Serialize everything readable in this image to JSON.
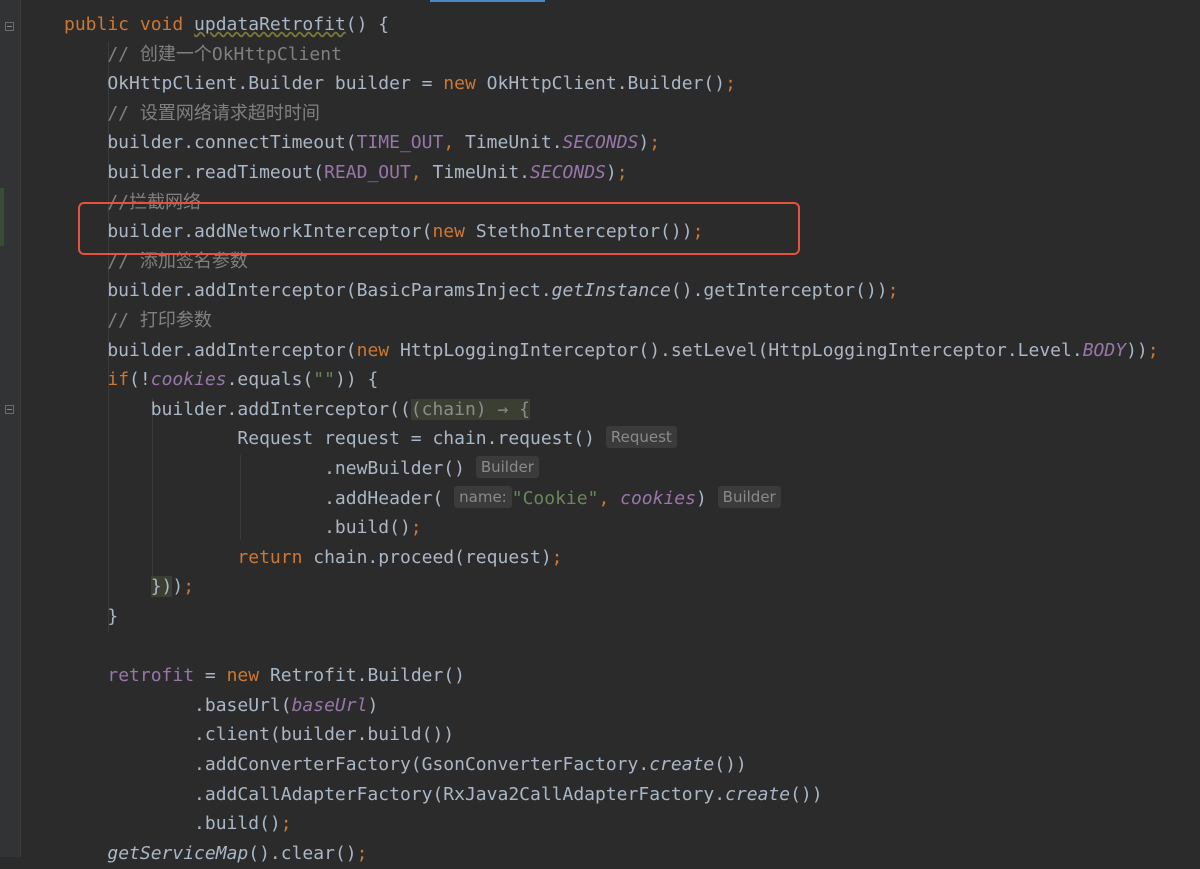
{
  "code": {
    "lines": [
      [
        {
          "t": "public void ",
          "c": "kw"
        },
        {
          "t": "updataRetrofit",
          "c": "sq"
        },
        {
          "t": "() {"
        }
      ],
      [
        {
          "t": "    // 创建一个OkHttpClient",
          "c": "cm"
        }
      ],
      [
        {
          "t": "    OkHttpClient.Builder builder = "
        },
        {
          "t": "new ",
          "c": "kw"
        },
        {
          "t": "OkHttpClient.Builder()"
        },
        {
          "t": ";",
          "c": "kw"
        }
      ],
      [
        {
          "t": "    // 设置网络请求超时时间",
          "c": "cm"
        }
      ],
      [
        {
          "t": "    builder.connectTimeout("
        },
        {
          "t": "TIME_OUT",
          "c": "fld"
        },
        {
          "t": ", ",
          "c": "kw"
        },
        {
          "t": "TimeUnit."
        },
        {
          "t": "SECONDS",
          "c": "fld ital"
        },
        {
          "t": ")"
        },
        {
          "t": ";",
          "c": "kw"
        }
      ],
      [
        {
          "t": "    builder.readTimeout("
        },
        {
          "t": "READ_OUT",
          "c": "fld"
        },
        {
          "t": ", ",
          "c": "kw"
        },
        {
          "t": "TimeUnit."
        },
        {
          "t": "SECONDS",
          "c": "fld ital"
        },
        {
          "t": ")"
        },
        {
          "t": ";",
          "c": "kw"
        }
      ],
      [
        {
          "t": "    //拦截网络",
          "c": "cm"
        }
      ],
      [
        {
          "t": "    builder.addNetworkInterceptor("
        },
        {
          "t": "new ",
          "c": "kw"
        },
        {
          "t": "StethoInterceptor())"
        },
        {
          "t": ";",
          "c": "kw"
        }
      ],
      [
        {
          "t": "    // 添加签名参数",
          "c": "cm"
        }
      ],
      [
        {
          "t": "    builder.addInterceptor(BasicParamsInject."
        },
        {
          "t": "getInstance",
          "c": "ital"
        },
        {
          "t": "().getInterceptor())"
        },
        {
          "t": ";",
          "c": "kw"
        }
      ],
      [
        {
          "t": "    // 打印参数",
          "c": "cm"
        }
      ],
      [
        {
          "t": "    builder.addInterceptor("
        },
        {
          "t": "new ",
          "c": "kw"
        },
        {
          "t": "HttpLoggingInterceptor().setLevel(HttpLoggingInterceptor.Level."
        },
        {
          "t": "BODY",
          "c": "fld ital"
        },
        {
          "t": "))"
        },
        {
          "t": ";",
          "c": "kw"
        }
      ],
      [
        {
          "t": "    "
        },
        {
          "t": "if",
          "c": "kw"
        },
        {
          "t": "(!"
        },
        {
          "t": "cookies",
          "c": "fld ital"
        },
        {
          "t": ".equals("
        },
        {
          "t": "\"\"",
          "c": "str"
        },
        {
          "t": ")) {"
        }
      ],
      [
        {
          "t": "        builder.addInterceptor(("
        },
        {
          "t": "(chain) → {",
          "c": "lam-hl"
        }
      ],
      [
        {
          "t": "                Request request = chain.request() "
        },
        {
          "t": "Request",
          "c": "chip"
        }
      ],
      [
        {
          "t": "                        .newBuilder() "
        },
        {
          "t": "Builder",
          "c": "chip"
        }
      ],
      [
        {
          "t": "                        .addHeader( "
        },
        {
          "t": "name:",
          "c": "chip"
        },
        {
          "t": "\"Cookie\"",
          "c": "str"
        },
        {
          "t": ", ",
          "c": "kw"
        },
        {
          "t": "cookies",
          "c": "fld ital"
        },
        {
          "t": ") "
        },
        {
          "t": "Builder",
          "c": "chip"
        }
      ],
      [
        {
          "t": "                        .build()"
        },
        {
          "t": ";",
          "c": "kw"
        }
      ],
      [
        {
          "t": "                "
        },
        {
          "t": "return ",
          "c": "kw"
        },
        {
          "t": "chain.proceed(request)"
        },
        {
          "t": ";",
          "c": "kw"
        }
      ],
      [
        {
          "t": "        "
        },
        {
          "t": "})",
          "c": "tail-hl"
        },
        {
          "t": ")"
        },
        {
          "t": ";",
          "c": "kw"
        }
      ],
      [
        {
          "t": "    }"
        }
      ],
      [
        {
          "t": ""
        }
      ],
      [
        {
          "t": "    "
        },
        {
          "t": "retrofit",
          "c": "fld"
        },
        {
          "t": " = "
        },
        {
          "t": "new ",
          "c": "kw"
        },
        {
          "t": "Retrofit.Builder()"
        }
      ],
      [
        {
          "t": "            .baseUrl("
        },
        {
          "t": "baseUrl",
          "c": "fld ital"
        },
        {
          "t": ")"
        }
      ],
      [
        {
          "t": "            .client(builder.build())"
        }
      ],
      [
        {
          "t": "            .addConverterFactory(GsonConverterFactory."
        },
        {
          "t": "create",
          "c": "ital"
        },
        {
          "t": "())"
        }
      ],
      [
        {
          "t": "            .addCallAdapterFactory(RxJava2CallAdapterFactory."
        },
        {
          "t": "create",
          "c": "ital"
        },
        {
          "t": "())"
        }
      ],
      [
        {
          "t": "            .build()"
        },
        {
          "t": ";",
          "c": "kw"
        }
      ],
      [
        {
          "t": "    "
        },
        {
          "t": "getServiceMap",
          "c": "ital"
        },
        {
          "t": "().clear()"
        },
        {
          "t": ";",
          "c": "kw"
        }
      ]
    ]
  },
  "colors": {
    "background": "#2b2b2b",
    "keyword": "#cc7832",
    "comment": "#808080",
    "field": "#9876aa",
    "string": "#6a8759",
    "default_text": "#a9b7c6",
    "annotation_box": "#e5533c"
  },
  "icons": [
    "fold-icon",
    "change-marker"
  ]
}
